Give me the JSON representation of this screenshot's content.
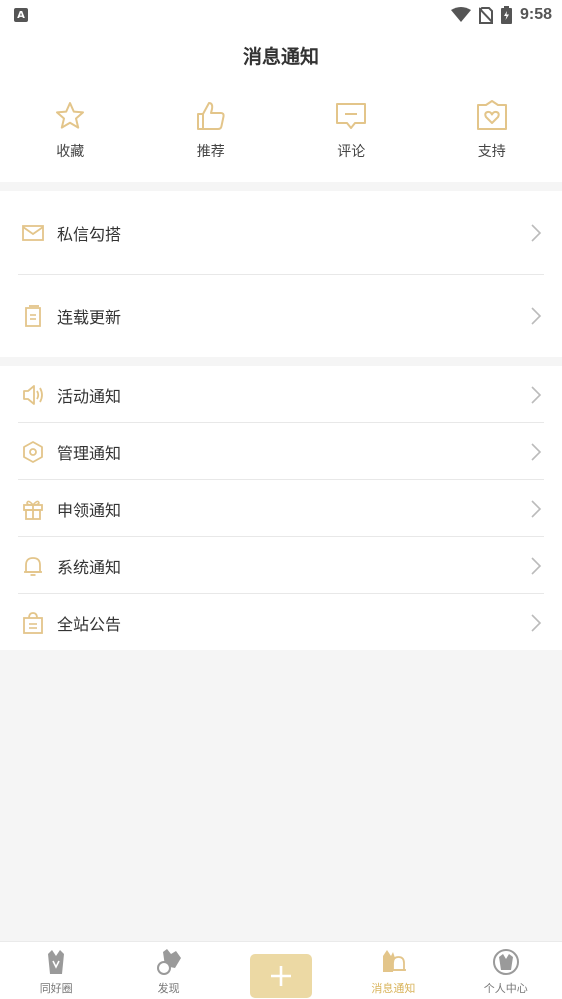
{
  "status": {
    "time": "9:58",
    "badge": "A"
  },
  "header": {
    "title": "消息通知"
  },
  "quick_actions": [
    {
      "label": "收藏",
      "icon": "star-icon"
    },
    {
      "label": "推荐",
      "icon": "thumbs-up-icon"
    },
    {
      "label": "评论",
      "icon": "comment-icon"
    },
    {
      "label": "支持",
      "icon": "heart-badge-icon"
    }
  ],
  "group1": [
    {
      "label": "私信勾搭",
      "icon": "mail-icon"
    },
    {
      "label": "连载更新",
      "icon": "book-icon"
    }
  ],
  "group2": [
    {
      "label": "活动通知",
      "icon": "speaker-icon"
    },
    {
      "label": "管理通知",
      "icon": "hexagon-icon"
    },
    {
      "label": "申领通知",
      "icon": "gift-icon"
    },
    {
      "label": "系统通知",
      "icon": "bell-icon"
    },
    {
      "label": "全站公告",
      "icon": "bag-icon"
    }
  ],
  "bottom_nav": [
    {
      "label": "同好圈"
    },
    {
      "label": "发现"
    },
    {
      "label": ""
    },
    {
      "label": "消息通知"
    },
    {
      "label": "个人中心"
    }
  ],
  "colors": {
    "accent": "#e3c58a",
    "active": "#d9b45c",
    "add_button": "#ecd9a4"
  }
}
